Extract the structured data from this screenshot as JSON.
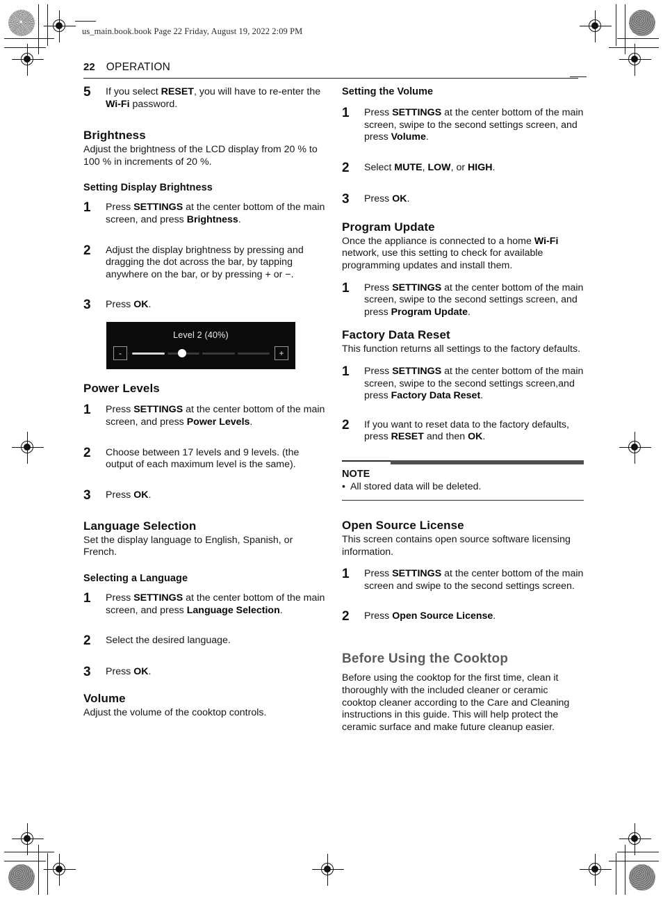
{
  "file_header": "us_main.book.book  Page 22  Friday, August 19, 2022  2:09 PM",
  "page": {
    "number": "22",
    "running_head": "OPERATION"
  },
  "left_column": {
    "step5": {
      "num": "5",
      "text_html": "If you select <b>RESET</b>, you will have to re-enter the <b>Wi-Fi</b> password."
    },
    "brightness": {
      "heading": "Brightness",
      "intro": "Adjust the brightness of the LCD display from 20 % to 100 % in increments of 20 %.",
      "sub_heading": "Setting Display Brightness",
      "steps": [
        {
          "num": "1",
          "text_html": "Press <b>SETTINGS</b> at the center bottom of the main screen, and press <b>Brightness</b>."
        },
        {
          "num": "2",
          "text_html": "Adjust the display brightness by pressing and dragging the dot across the bar, by tapping anywhere on the bar, or by pressing + or &#8722;."
        },
        {
          "num": "3",
          "text_html": "Press <b>OK</b>."
        }
      ],
      "slider": {
        "label": "Level 2 (40%)",
        "minus": "-",
        "plus": "+",
        "segments": 5,
        "filled_segments": 1,
        "value_percent": 40,
        "level": 2
      }
    },
    "power_levels": {
      "heading": "Power Levels",
      "steps": [
        {
          "num": "1",
          "text_html": "Press <b>SETTINGS</b> at the center bottom of the main screen, and press <b>Power Levels</b>."
        },
        {
          "num": "2",
          "text_html": "Choose between 17 levels and 9 levels. (the output of each maximum level is the same)."
        },
        {
          "num": "3",
          "text_html": "Press <b>OK</b>."
        }
      ]
    },
    "language_selection": {
      "heading": "Language Selection",
      "intro": "Set the display language to English, Spanish, or French.",
      "sub_heading": "Selecting a Language",
      "steps": [
        {
          "num": "1",
          "text_html": "Press <b>SETTINGS</b> at the center bottom of the main screen, and press <b>Language Selection</b>."
        },
        {
          "num": "2",
          "text_html": "Select the desired language."
        },
        {
          "num": "3",
          "text_html": "Press <b>OK</b>."
        }
      ]
    },
    "volume": {
      "heading": "Volume",
      "intro": "Adjust the volume of the cooktop controls."
    }
  },
  "right_column": {
    "setting_the_volume": {
      "heading": "Setting the Volume",
      "steps": [
        {
          "num": "1",
          "text_html": "Press <b>SETTINGS</b> at the center bottom of the main screen, swipe to the second settings screen, and press <b>Volume</b>."
        },
        {
          "num": "2",
          "text_html": "Select <b>MUTE</b>, <b>LOW</b>, or <b>HIGH</b>."
        },
        {
          "num": "3",
          "text_html": "Press <b>OK</b>."
        }
      ]
    },
    "program_update": {
      "heading": "Program Update",
      "intro_html": "Once the appliance is connected to a home <b>Wi-Fi</b> network, use this setting to check for available programming updates and install them.",
      "steps": [
        {
          "num": "1",
          "text_html": "Press <b>SETTINGS</b> at the center bottom of the main screen, swipe to the second settings screen, and press <b>Program Update</b>."
        }
      ]
    },
    "factory_data_reset": {
      "heading": "Factory Data Reset",
      "intro": "This function returns all settings to the factory defaults.",
      "steps": [
        {
          "num": "1",
          "text_html": "Press <b>SETTINGS</b> at the center bottom of the main screen, swipe to the second settings screen,and press <b>Factory Data Reset</b>."
        },
        {
          "num": "2",
          "text_html": "If you want to reset data to the factory defaults, press <b>RESET</b> and then <b>OK</b>."
        }
      ]
    },
    "note": {
      "title": "NOTE",
      "bullet": "•",
      "items": [
        "All stored data will be deleted."
      ]
    },
    "open_source_license": {
      "heading": "Open Source License",
      "intro": "This screen contains open source software licensing information.",
      "steps": [
        {
          "num": "1",
          "text_html": "Press <b>SETTINGS</b> at the center bottom of the main screen and swipe to the second settings screen."
        },
        {
          "num": "2",
          "text_html": "Press <b>Open Source License</b>."
        }
      ]
    },
    "before_using_the_cooktop": {
      "heading": "Before Using the Cooktop",
      "body": "Before using the cooktop for the first time, clean it thoroughly with the included cleaner or ceramic cooktop cleaner according to the Care and Cleaning instructions in this guide. This will help protect the ceramic surface and make future cleanup easier."
    }
  },
  "colors": {
    "text": "#161616",
    "heading_gray": "#5b5b5b",
    "rule": "#1d1d1d",
    "note_bar": "#4f4f4f",
    "slider_bg": "#0b0b0b",
    "slider_fill": "#d8d8d8",
    "slider_empty": "#3a3a3a"
  }
}
